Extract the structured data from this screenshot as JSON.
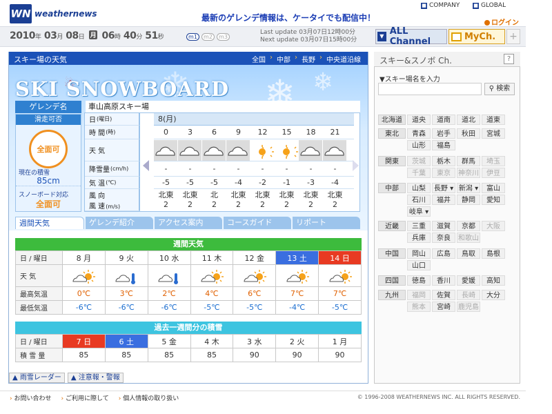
{
  "header": {
    "logo_mark": "WN",
    "logo_name": "weathernews",
    "promo": "最新のゲレンデ情報は、ケータイでも配信中！",
    "company": "COMPANY",
    "global": "GLOBAL",
    "login": "ログイン"
  },
  "datebar": {
    "year": "2010",
    "year_unit": "年",
    "month": "03",
    "month_unit": "月",
    "day": "08",
    "day_unit": "日",
    "dow": "月",
    "hour": "06",
    "hour_unit": "時",
    "minute": "40",
    "minute_unit": "分",
    "second": "51",
    "second_unit": "秒",
    "m_buttons": [
      "m1",
      "m2",
      "m3"
    ],
    "last_update_label": "Last update",
    "last_update": "03月07日12時00分",
    "next_update_label": "Next update",
    "next_update": "03月07日15時00分",
    "all_channel": "ALL Channel",
    "mych": "MyCh.",
    "plus": "+"
  },
  "main": {
    "title": "スキー場の天気",
    "breadcrumbs": [
      "全国",
      "中部",
      "長野",
      "中央道沿線"
    ],
    "banner_title": "SKI SNOWBOARD",
    "gelende_label": "ゲレンデ名",
    "gelende_name": "車山高原スキー場",
    "ski_status_label": "滑走可否",
    "ski_status": "全面可",
    "current_snow_label": "現在の積雪",
    "current_snow": "85cm",
    "snowboard_label": "スノーボード対応",
    "snowboard_status": "全面可",
    "hourly": {
      "labels": {
        "day": "日",
        "day_sub": "(曜日)",
        "time": "時 間",
        "time_sub": "(時)",
        "weather": "天 気",
        "precip": "降雪量",
        "precip_sub": "(cm/h)",
        "temp": "気 温",
        "temp_sub": "(℃)",
        "wind_dir": "風 向",
        "wind_speed": "風 速",
        "wind_speed_sub": "(m/s)"
      },
      "date": "8(月)",
      "hours": [
        "0",
        "3",
        "6",
        "9",
        "12",
        "15",
        "18",
        "21"
      ],
      "weather": [
        "cloud",
        "cloud",
        "cloud",
        "cloud",
        "sunny",
        "sunny",
        "cloud",
        "cloud"
      ],
      "precip": [
        "-",
        "-",
        "-",
        "-",
        "-",
        "-",
        "-",
        "-"
      ],
      "temp": [
        "-5",
        "-5",
        "-5",
        "-4",
        "-2",
        "-1",
        "-3",
        "-4"
      ],
      "wind_dir": [
        "北東",
        "北東",
        "北",
        "北東",
        "北東",
        "北東",
        "北東",
        "北東"
      ],
      "wind_speed": [
        "2",
        "2",
        "2",
        "2",
        "2",
        "2",
        "2",
        "2"
      ]
    },
    "tabs": [
      "週間天気",
      "ゲレンデ紹介",
      "アクセス案内",
      "コースガイド",
      "リポート"
    ],
    "weekly": {
      "title": "週間天気",
      "row_labels": [
        "日 / 曜日",
        "天 気",
        "最高気温",
        "最低気温"
      ],
      "days": [
        "8 月",
        "9 火",
        "10 水",
        "11 木",
        "12 金",
        "13 土",
        "14 日"
      ],
      "weather": [
        "cloud-sun",
        "cloud-snow",
        "cloud-snow",
        "cloud-sun",
        "cloud-sun",
        "cloud-sun",
        "cloud-sun"
      ],
      "high": [
        "0℃",
        "3℃",
        "2℃",
        "4℃",
        "6℃",
        "7℃",
        "7℃"
      ],
      "low": [
        "-6℃",
        "-6℃",
        "-6℃",
        "-5℃",
        "-5℃",
        "-4℃",
        "-5℃"
      ]
    },
    "snow_week": {
      "title": "過去一週間分の積雪",
      "row_labels": [
        "日 / 曜日",
        "積 雪 量"
      ],
      "days": [
        "7 日",
        "6 土",
        "5 金",
        "4 木",
        "3 水",
        "2 火",
        "1 月"
      ],
      "values": [
        "85",
        "85",
        "85",
        "85",
        "90",
        "90",
        "90"
      ]
    },
    "bottom_tabs": [
      "雨雪レーダー",
      "注意報・警報"
    ]
  },
  "right": {
    "title": "スキー&スノボ Ch.",
    "help": "?",
    "input_label": "▼スキー場名を入力",
    "search": "検索",
    "regions": [
      {
        "name": "北海道",
        "prefs": [
          {
            "n": "道央",
            "on": true
          },
          {
            "n": "道南",
            "on": true
          },
          {
            "n": "道北",
            "on": true
          },
          {
            "n": "道東",
            "on": true
          }
        ]
      },
      {
        "name": "東北",
        "prefs": [
          {
            "n": "青森",
            "on": true
          },
          {
            "n": "岩手",
            "on": true
          },
          {
            "n": "秋田",
            "on": true
          },
          {
            "n": "宮城",
            "on": true
          },
          {
            "n": "山形",
            "on": true
          },
          {
            "n": "福島",
            "on": true
          }
        ]
      },
      {
        "name": "関東",
        "prefs": [
          {
            "n": "茨城",
            "on": false
          },
          {
            "n": "栃木",
            "on": true
          },
          {
            "n": "群馬",
            "on": true
          },
          {
            "n": "埼玉",
            "on": false
          },
          {
            "n": "千葉",
            "on": false
          },
          {
            "n": "東京",
            "on": false
          },
          {
            "n": "神奈川",
            "on": false
          },
          {
            "n": "伊豆",
            "on": false
          }
        ]
      },
      {
        "name": "中部",
        "prefs": [
          {
            "n": "山梨",
            "on": true
          },
          {
            "n": "長野 ▾",
            "on": true
          },
          {
            "n": "新潟 ▾",
            "on": true
          },
          {
            "n": "富山",
            "on": true
          },
          {
            "n": "石川",
            "on": true
          },
          {
            "n": "福井",
            "on": true
          },
          {
            "n": "静岡",
            "on": true
          },
          {
            "n": "愛知",
            "on": true
          },
          {
            "n": "岐阜 ▾",
            "on": true
          }
        ]
      },
      {
        "name": "近畿",
        "prefs": [
          {
            "n": "三重",
            "on": true
          },
          {
            "n": "滋賀",
            "on": true
          },
          {
            "n": "京都",
            "on": true
          },
          {
            "n": "大阪",
            "on": false
          },
          {
            "n": "兵庫",
            "on": true
          },
          {
            "n": "奈良",
            "on": true
          },
          {
            "n": "和歌山",
            "on": false
          }
        ]
      },
      {
        "name": "中国",
        "prefs": [
          {
            "n": "岡山",
            "on": true
          },
          {
            "n": "広島",
            "on": true
          },
          {
            "n": "鳥取",
            "on": true
          },
          {
            "n": "島根",
            "on": true
          },
          {
            "n": "山口",
            "on": true
          }
        ]
      },
      {
        "name": "四国",
        "prefs": [
          {
            "n": "徳島",
            "on": true
          },
          {
            "n": "香川",
            "on": true
          },
          {
            "n": "愛媛",
            "on": true
          },
          {
            "n": "高知",
            "on": true
          }
        ]
      },
      {
        "name": "九州",
        "prefs": [
          {
            "n": "福岡",
            "on": false
          },
          {
            "n": "佐賀",
            "on": true
          },
          {
            "n": "長崎",
            "on": false
          },
          {
            "n": "大分",
            "on": true
          },
          {
            "n": "熊本",
            "on": false
          },
          {
            "n": "宮崎",
            "on": true
          },
          {
            "n": "鹿児島",
            "on": false
          }
        ]
      }
    ]
  },
  "footer": {
    "links": [
      "お問い合わせ",
      "ご利用に際して",
      "個人情報の取り扱い"
    ],
    "copyright": "© 1996-2008 WEATHERNEWS INC. ALL RIGHTS RESERVED."
  },
  "colors": {
    "brand": "#1b3f94",
    "accent": "#f09020",
    "weekly_bar": "#3dbb3d",
    "snow_bar": "#3dc4e0",
    "saturday": "#3a6ee0",
    "sunday": "#e83a22"
  }
}
